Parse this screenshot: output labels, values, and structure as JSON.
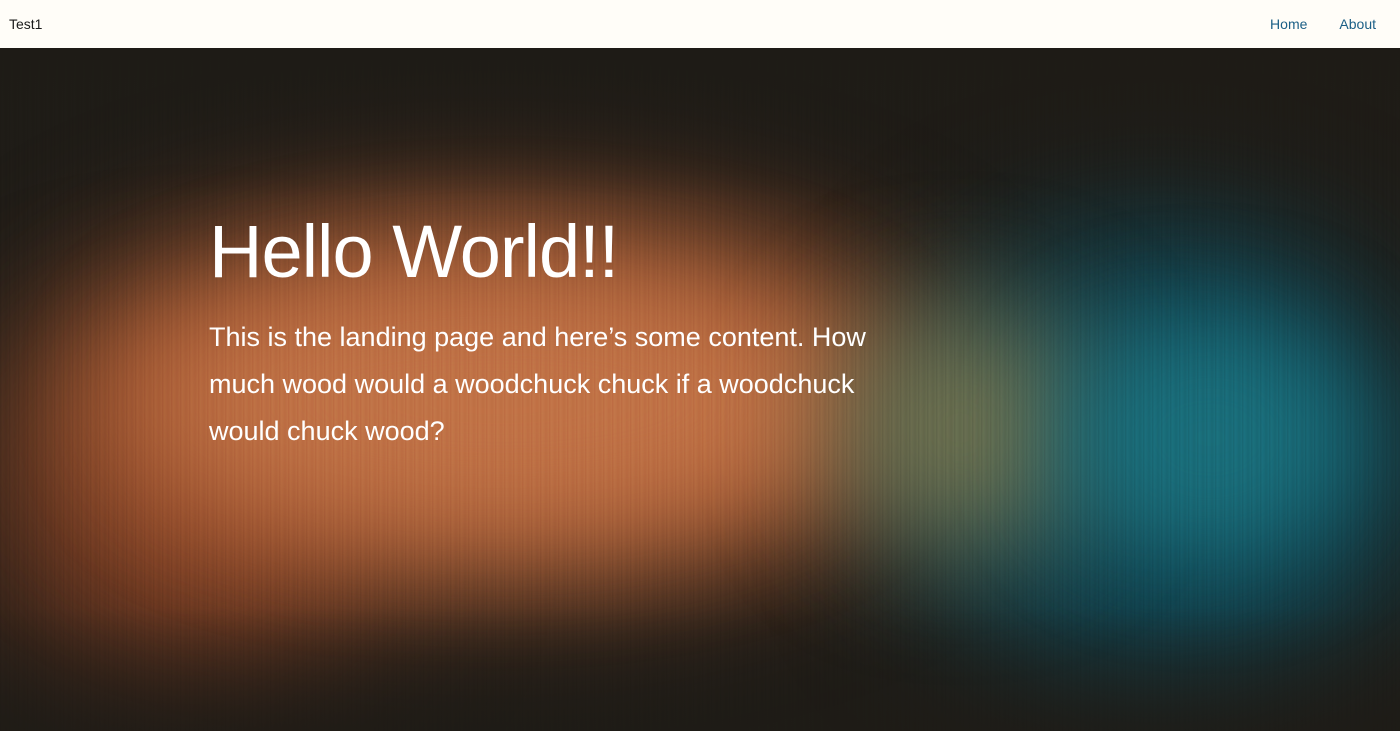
{
  "navbar": {
    "brand": "Test1",
    "links": [
      {
        "label": "Home"
      },
      {
        "label": "About"
      }
    ],
    "link_color": "#1b5f86"
  },
  "hero": {
    "title": "Hello World!!",
    "text": "This is the landing page and here’s some content. How much wood would a woodchuck chuck if a woodchuck would chuck wood?",
    "colors": {
      "orange": "#c27548",
      "teal": "#1a6f7c",
      "dark": "#1e1b16"
    }
  }
}
